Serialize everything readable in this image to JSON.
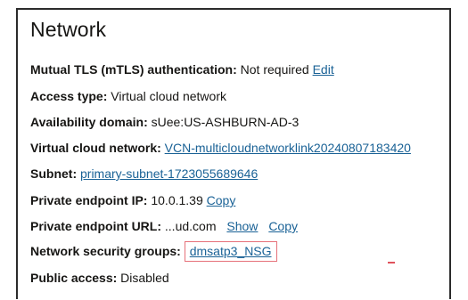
{
  "title": "Network",
  "rows": {
    "mtls": {
      "label": "Mutual TLS (mTLS) authentication:",
      "value": "Not required",
      "link": "Edit"
    },
    "access": {
      "label": "Access type:",
      "value": "Virtual cloud network"
    },
    "ad": {
      "label": "Availability domain:",
      "value": "sUee:US-ASHBURN-AD-3"
    },
    "vcn": {
      "label": "Virtual cloud network:",
      "link": "VCN-multicloudnetworklink20240807183420"
    },
    "subnet": {
      "label": "Subnet:",
      "link": "primary-subnet-1723055689646"
    },
    "pip": {
      "label": "Private endpoint IP:",
      "value": "10.0.1.39",
      "link": "Copy"
    },
    "purl": {
      "label": "Private endpoint URL:",
      "value": "...ud.com",
      "show": "Show",
      "copy": "Copy"
    },
    "nsg": {
      "label": "Network security groups:",
      "link": "dmsatp3_NSG"
    },
    "public": {
      "label": "Public access:",
      "value": "Disabled"
    }
  },
  "colors": {
    "link": "#1a6296",
    "highlight_box": "#e6717a",
    "border": "#2b2b2b"
  }
}
